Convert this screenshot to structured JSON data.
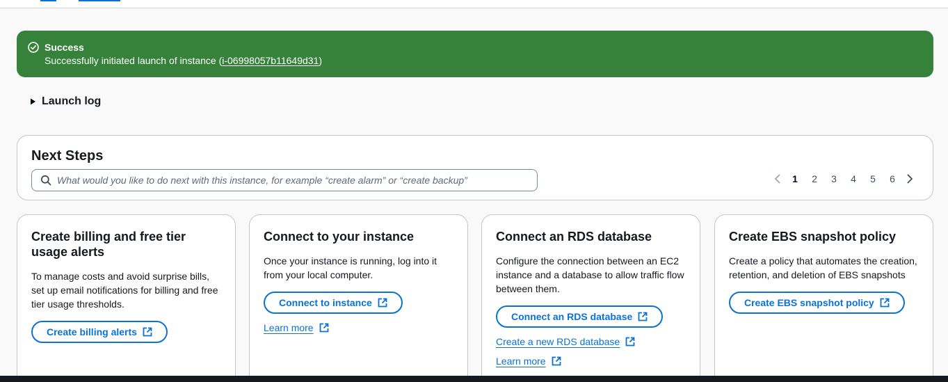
{
  "flash": {
    "title": "Success",
    "message_prefix": "Successfully initiated launch of instance (",
    "instance_id": "i-06998057b11649d31",
    "message_suffix": ")",
    "color": "#37823b"
  },
  "launch_log": {
    "label": "Launch log"
  },
  "next_steps": {
    "title": "Next Steps",
    "search_placeholder": "What would you like to do next with this instance, for example “create alarm” or “create backup”",
    "pages": [
      "1",
      "2",
      "3",
      "4",
      "5",
      "6"
    ],
    "current_page": "1"
  },
  "cards": [
    {
      "title": "Create billing and free tier usage alerts",
      "description": "To manage costs and avoid surprise bills, set up email notifications for billing and free tier usage thresholds.",
      "button": "Create billing alerts"
    },
    {
      "title": "Connect to your instance",
      "description": "Once your instance is running, log into it from your local computer.",
      "button": "Connect to instance",
      "link1": "Learn more"
    },
    {
      "title": "Connect an RDS database",
      "description": "Configure the connection between an EC2 instance and a database to allow traffic flow between them.",
      "button": "Connect an RDS database",
      "link1": "Create a new RDS database",
      "link2": "Learn more"
    },
    {
      "title": "Create EBS snapshot policy",
      "description": "Create a policy that automates the creation, retention, and deletion of EBS snapshots",
      "button": "Create EBS snapshot policy"
    }
  ],
  "colors": {
    "link": "#0972d3",
    "text": "#16191f",
    "page_bg": "#f9f9fa"
  }
}
